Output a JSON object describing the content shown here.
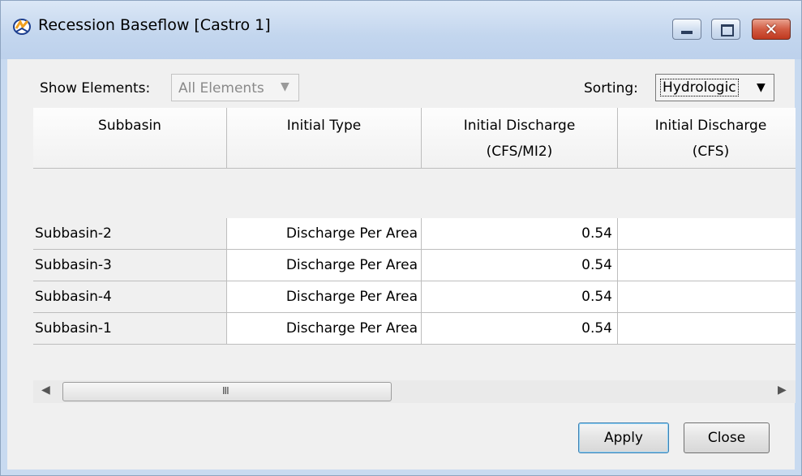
{
  "window": {
    "title": "Recession Baseflow [Castro 1]",
    "controls": {
      "minimize": "minimize",
      "maximize": "maximize",
      "close": "✕"
    }
  },
  "filters": {
    "show_label": "Show Elements:",
    "show_value": "All Elements",
    "sort_label": "Sorting:",
    "sort_value": "Hydrologic"
  },
  "table": {
    "columns": [
      "Subbasin",
      "Initial Type",
      "Initial Discharge\n(CFS/MI2)",
      "Initial Discharge\n(CFS)"
    ],
    "rows": [
      {
        "subbasin": "Subbasin-2",
        "initial_type": "Discharge Per Area",
        "discharge_per_area": "0.54",
        "discharge": ""
      },
      {
        "subbasin": "Subbasin-3",
        "initial_type": "Discharge Per Area",
        "discharge_per_area": "0.54",
        "discharge": ""
      },
      {
        "subbasin": "Subbasin-4",
        "initial_type": "Discharge Per Area",
        "discharge_per_area": "0.54",
        "discharge": ""
      },
      {
        "subbasin": "Subbasin-1",
        "initial_type": "Discharge Per Area",
        "discharge_per_area": "0.54",
        "discharge": ""
      }
    ]
  },
  "scrollbar": {
    "grip": "III"
  },
  "buttons": {
    "apply": "Apply",
    "close": "Close"
  },
  "colors": {
    "titlebar": "#c3d6ee",
    "close_button": "#c0391f",
    "client_bg": "#f0f0f0"
  }
}
